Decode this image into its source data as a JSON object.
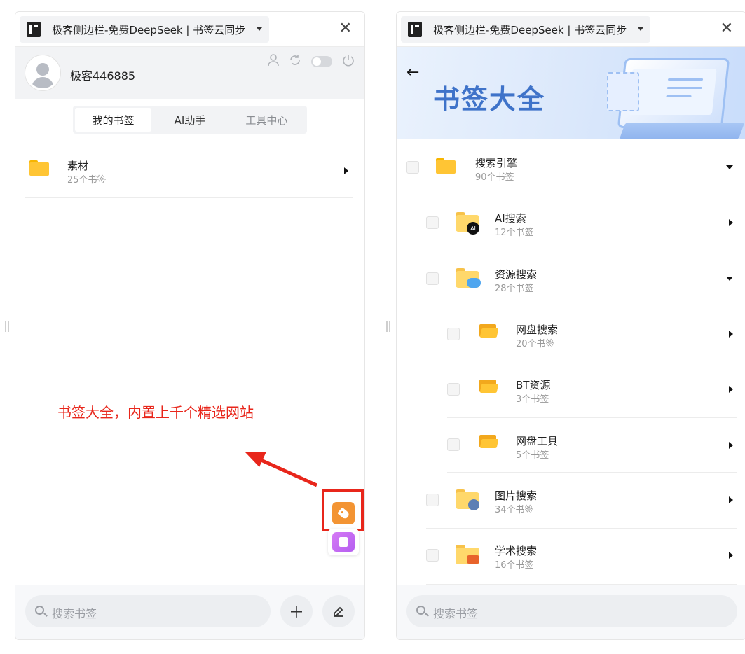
{
  "app": {
    "title": "极客侧边栏-免费DeepSeek | 书签云同步"
  },
  "left": {
    "username": "极客446885",
    "tabs": [
      {
        "label": "我的书签",
        "active": true
      },
      {
        "label": "AI助手",
        "active": false
      },
      {
        "label": "工具中心",
        "active": false
      }
    ],
    "folder": {
      "title": "素材",
      "count": "25个书签"
    },
    "annotation": "书签大全，内置上千个精选网站",
    "search_placeholder": "搜索书签"
  },
  "right": {
    "banner_title": "书签大全",
    "tree": [
      {
        "title": "搜索引擎",
        "count": "90个书签",
        "level": 0,
        "expanded": true
      },
      {
        "title": "AI搜索",
        "count": "12个书签",
        "level": 1,
        "expanded": false,
        "badge": "AI"
      },
      {
        "title": "资源搜索",
        "count": "28个书签",
        "level": 1,
        "expanded": true
      },
      {
        "title": "网盘搜索",
        "count": "20个书签",
        "level": 2,
        "expanded": false
      },
      {
        "title": "BT资源",
        "count": "3个书签",
        "level": 2,
        "expanded": false
      },
      {
        "title": "网盘工具",
        "count": "5个书签",
        "level": 2,
        "expanded": false
      },
      {
        "title": "图片搜索",
        "count": "34个书签",
        "level": 1,
        "expanded": false
      },
      {
        "title": "学术搜索",
        "count": "16个书签",
        "level": 1,
        "expanded": false
      }
    ],
    "search_placeholder": "搜索书签"
  },
  "colors": {
    "annotation_red": "#e8261b",
    "folder_yellow": "#ffc534",
    "bookmark_button": "#f39433",
    "note_button": "#c06cf2",
    "banner_text": "#3f73c9"
  },
  "icons": [
    "app-logo-icon",
    "chevron-down-icon",
    "close-icon",
    "user-icon",
    "sync-icon",
    "theme-toggle",
    "power-icon",
    "folder-icon",
    "triangle-right-icon",
    "triangle-down-icon",
    "tag-icon",
    "note-icon",
    "search-icon",
    "plus-icon",
    "edit-icon",
    "back-arrow-icon"
  ]
}
